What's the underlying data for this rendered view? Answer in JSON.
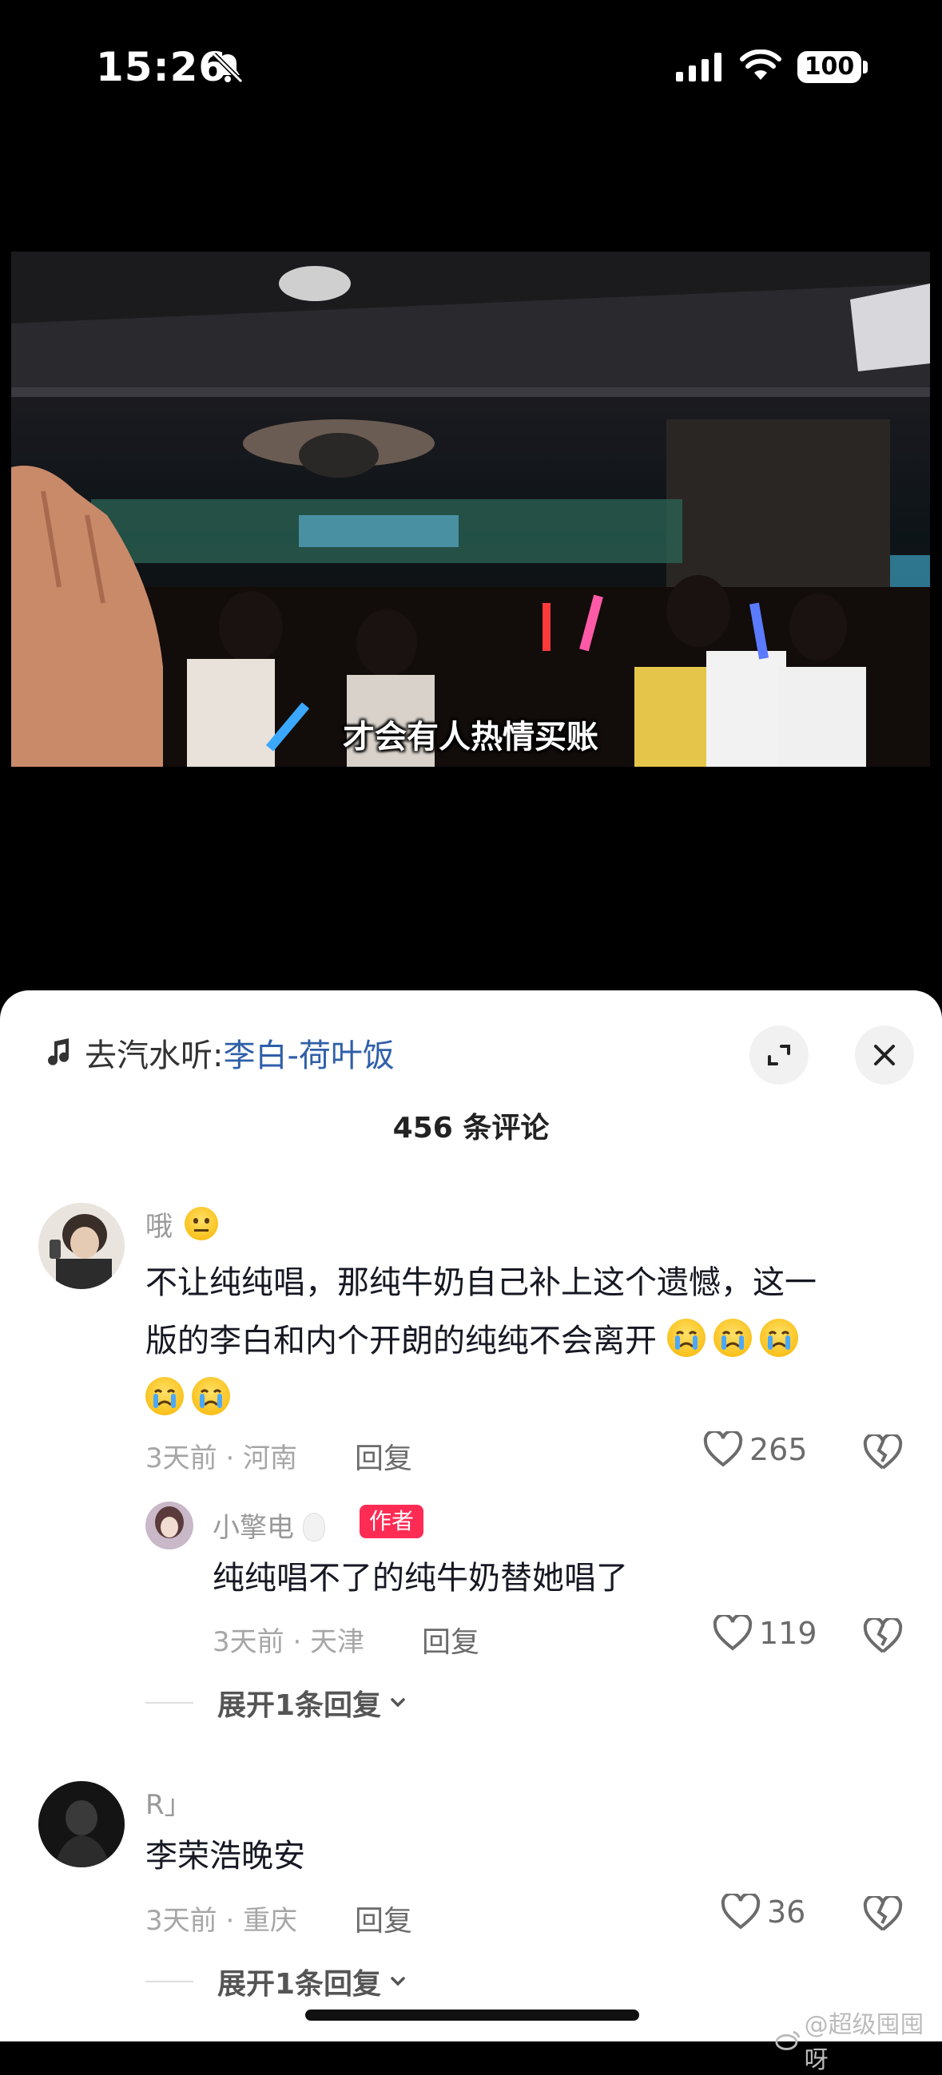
{
  "status_bar": {
    "time": "15:26",
    "battery": "100"
  },
  "video": {
    "subtitle": "才会有人热情买账"
  },
  "sheet": {
    "music": {
      "prefix": "去汽水听:",
      "song": "李白-荷叶饭"
    },
    "comment_count": "456 条评论",
    "comments": [
      {
        "user": "哦",
        "text_line1": "不让纯纯唱，那纯牛奶自己补上这个遗憾，这一",
        "text_line2": "版的李白和内个开朗的纯纯不会离开",
        "meta": "3天前 · 河南",
        "reply": "回复",
        "likes": "265"
      },
      {
        "user": "小擎电",
        "badge": "作者",
        "text": "纯纯唱不了的纯牛奶替她唱了",
        "meta": "3天前 · 天津",
        "reply": "回复",
        "likes": "119",
        "expand": "展开1条回复"
      },
      {
        "user": "R」",
        "text": "李荣浩晚安",
        "meta": "3天前 · 重庆",
        "reply": "回复",
        "likes": "36",
        "expand": "展开1条回复"
      }
    ]
  },
  "watermark": "@超级囤囤呀"
}
